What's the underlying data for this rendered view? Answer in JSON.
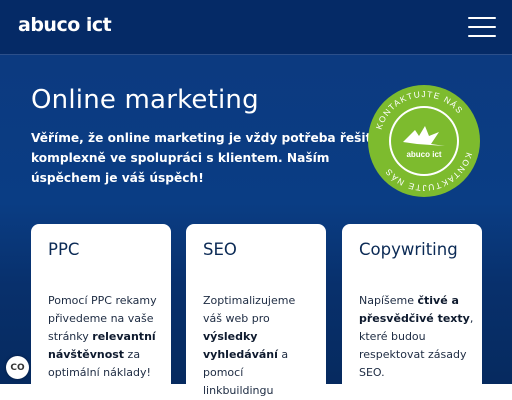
{
  "header": {
    "logo": "abuco ict",
    "menu_icon": "hamburger-menu-icon"
  },
  "hero": {
    "title": "Online marketing",
    "lead_lines": [
      "Věříme, že online marketing je vždy potřeba řešit",
      "komplexně ve spolupráci s klientem. Naším",
      "úspěchem je váš úspěch!"
    ]
  },
  "badge": {
    "text": "KONTAKTUJTE NÁS",
    "logo": "abuco ict",
    "color": "#7dbb2e"
  },
  "cards": [
    {
      "title": "PPC",
      "lines": [
        [
          {
            "t": "Pomocí PPC rekamy",
            "b": false
          }
        ],
        [
          {
            "t": "přivedeme na vaše",
            "b": false
          }
        ],
        [
          {
            "t": "stránky ",
            "b": false
          },
          {
            "t": "relevantní",
            "b": true
          }
        ],
        [
          {
            "t": "návštěvnost",
            "b": true
          },
          {
            "t": " za",
            "b": false
          }
        ],
        [
          {
            "t": "optimální náklady!",
            "b": false
          }
        ]
      ]
    },
    {
      "title": "SEO",
      "lines": [
        [
          {
            "t": "Zoptimalizujeme",
            "b": false
          }
        ],
        [
          {
            "t": "váš web pro",
            "b": false
          }
        ],
        [
          {
            "t": "výsledky",
            "b": true
          }
        ],
        [
          {
            "t": "vyhledávání",
            "b": true
          },
          {
            "t": " a",
            "b": false
          }
        ],
        [
          {
            "t": "pomocí",
            "b": false
          }
        ],
        [
          {
            "t": "linkbuildingu",
            "b": false
          }
        ]
      ]
    },
    {
      "title": "Copywriting",
      "lines": [
        [
          {
            "t": "Napíšeme ",
            "b": false
          },
          {
            "t": "čtivé a",
            "b": true
          }
        ],
        [
          {
            "t": "přesvědčivé texty",
            "b": true
          },
          {
            "t": ",",
            "b": false
          }
        ],
        [
          {
            "t": "které budou",
            "b": false
          }
        ],
        [
          {
            "t": "respektovat zásady",
            "b": false
          }
        ],
        [
          {
            "t": "SEO.",
            "b": false
          }
        ]
      ]
    }
  ],
  "cookie": {
    "label": "CO",
    "icon": "cookie-settings-icon"
  }
}
